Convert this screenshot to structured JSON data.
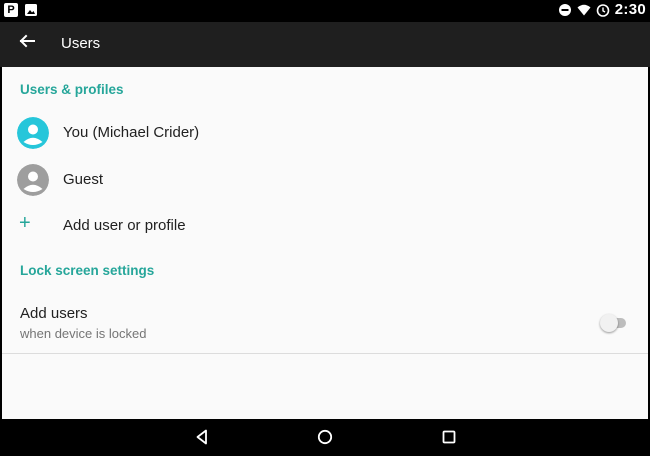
{
  "status_bar": {
    "time": "2:30",
    "left_icons": [
      "p-notification-icon",
      "image-notification-icon"
    ],
    "right_icons": [
      "do-not-disturb-icon",
      "wifi-icon",
      "alarm-icon"
    ]
  },
  "app_bar": {
    "title": "Users",
    "back_icon": "arrow-back-icon"
  },
  "sections": {
    "users_profiles": {
      "header": "Users & profiles",
      "items": [
        {
          "label": "You (Michael Crider)",
          "avatar_color": "#26c6da"
        },
        {
          "label": "Guest",
          "avatar_color": "#9e9e9e"
        }
      ],
      "add": {
        "label": "Add user or profile",
        "icon": "+"
      }
    },
    "lock_screen": {
      "header": "Lock screen settings",
      "setting": {
        "title": "Add users",
        "subtitle": "when device is locked",
        "enabled": false
      }
    }
  },
  "nav_bar": {
    "buttons": [
      "back-nav-icon",
      "home-nav-icon",
      "recents-nav-icon"
    ]
  },
  "colors": {
    "accent": "#26a69a",
    "app_bar": "#1f1f1f",
    "background": "#fafafa"
  }
}
